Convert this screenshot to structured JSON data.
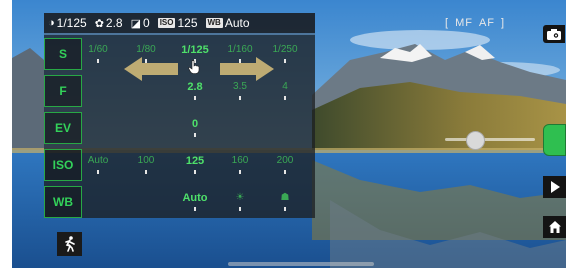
{
  "topbar": {
    "shutter": "1/125",
    "aperture": "2.8",
    "ev": "0",
    "iso_badge": "ISO",
    "iso": "125",
    "wb_badge": "WB",
    "wb": "Auto"
  },
  "focus_mode": {
    "mf": "MF",
    "af": "AF",
    "open": "[",
    "close": "]"
  },
  "panel": {
    "rows": [
      {
        "label": "S",
        "values": [
          "1/60",
          "1/80",
          "1/125",
          "1/160",
          "1/250"
        ],
        "selected": 2
      },
      {
        "label": "F",
        "values": [
          "",
          "",
          "2.8",
          "3.5",
          "4"
        ],
        "selected": 2
      },
      {
        "label": "EV",
        "values": [
          "",
          "",
          "0",
          "",
          ""
        ],
        "selected": 2
      },
      {
        "label": "ISO",
        "values": [
          "Auto",
          "100",
          "125",
          "160",
          "200"
        ],
        "selected": 2
      },
      {
        "label": "WB",
        "values": [
          "",
          "",
          "Auto",
          "☀",
          "☗"
        ],
        "selected": 2
      }
    ]
  },
  "icons": {
    "camera": "camera-icon",
    "play": "play-icon",
    "home": "home-icon",
    "person": "person-icon",
    "hand": "hand-pointer-icon",
    "arrow_left": "arrow-left-icon",
    "arrow_right": "arrow-right-icon"
  },
  "colors": {
    "accent": "#33d15a",
    "shutter_button": "#2fbf50"
  }
}
